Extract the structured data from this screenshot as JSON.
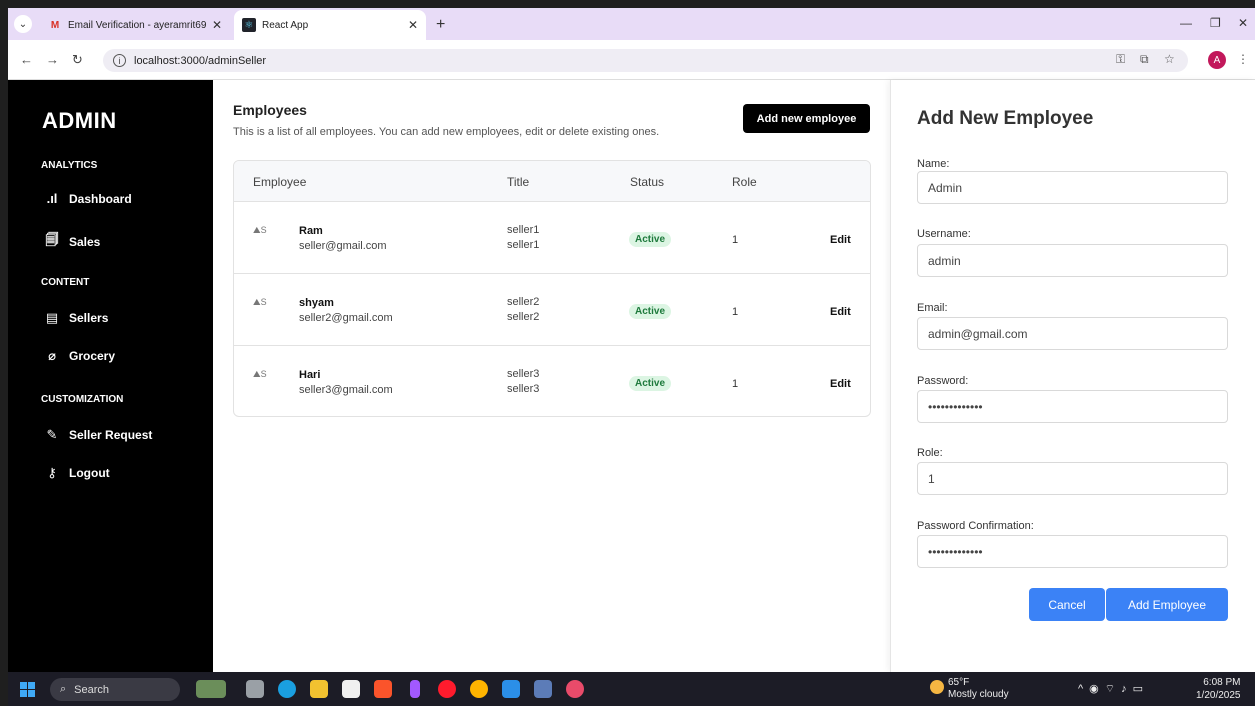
{
  "browser": {
    "tabs": [
      {
        "title": "Email Verification - ayeramrit69",
        "favicon": "M"
      },
      {
        "title": "React App",
        "favicon": "⚛"
      }
    ],
    "url": "localhost:3000/adminSeller",
    "profile_initial": "A"
  },
  "sidebar": {
    "brand": "ADMIN",
    "sections": {
      "analytics": "ANALYTICS",
      "content": "CONTENT",
      "customization": "CUSTOMIZATION"
    },
    "items": [
      {
        "label": "Dashboard",
        "icon": "chart-icon"
      },
      {
        "label": "Sales",
        "icon": "receipt-icon"
      },
      {
        "label": "Sellers",
        "icon": "list-icon"
      },
      {
        "label": "Grocery",
        "icon": "paperclip-icon"
      },
      {
        "label": "Seller Request",
        "icon": "pen-icon"
      },
      {
        "label": "Logout",
        "icon": "key-icon"
      }
    ]
  },
  "main": {
    "title": "Employees",
    "subtitle": "This is a list of all employees. You can add new employees, edit or delete existing ones.",
    "add_button": "Add new employee",
    "columns": [
      "Employee",
      "Title",
      "Status",
      "Role"
    ],
    "rows": [
      {
        "avatar_alt": "S",
        "name": "Ram",
        "email": "seller@gmail.com",
        "title": "seller1",
        "title2": "seller1",
        "status": "Active",
        "role": "1",
        "action": "Edit"
      },
      {
        "avatar_alt": "S",
        "name": "shyam",
        "email": "seller2@gmail.com",
        "title": "seller2",
        "title2": "seller2",
        "status": "Active",
        "role": "1",
        "action": "Edit"
      },
      {
        "avatar_alt": "S",
        "name": "Hari",
        "email": "seller3@gmail.com",
        "title": "seller3",
        "title2": "seller3",
        "status": "Active",
        "role": "1",
        "action": "Edit"
      }
    ]
  },
  "panel": {
    "title": "Add New Employee",
    "fields": {
      "name": {
        "label": "Name:",
        "value": "Admin"
      },
      "username": {
        "label": "Username:",
        "value": "admin"
      },
      "email": {
        "label": "Email:",
        "value": "admin@gmail.com"
      },
      "password": {
        "label": "Password:",
        "value": "•••••••••••••"
      },
      "role": {
        "label": "Role:",
        "value": "1"
      },
      "password_confirmation": {
        "label": "Password Confirmation:",
        "value": "•••••••••••••"
      }
    },
    "cancel": "Cancel",
    "submit": "Add Employee"
  },
  "taskbar": {
    "search": "Search",
    "weather_temp": "65°F",
    "weather_desc": "Mostly cloudy",
    "time": "6:08 PM",
    "date": "1/20/2025"
  }
}
